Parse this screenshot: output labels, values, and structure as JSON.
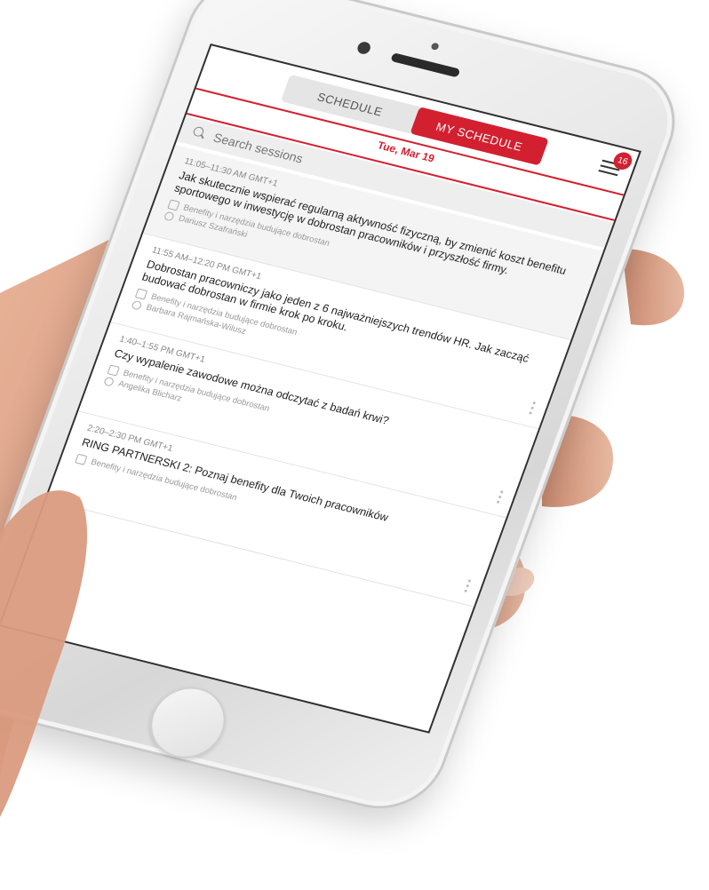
{
  "tabs": [
    {
      "label": "SCHEDULE",
      "active": false
    },
    {
      "label": "MY SCHEDULE",
      "active": true
    }
  ],
  "badge_count": "16",
  "date": "Tue, Mar 19",
  "search": {
    "placeholder": "Search sessions"
  },
  "sessions": [
    {
      "time": "11:05–11:30 AM GMT+1",
      "title": "Jak skutecznie wspierać regularną aktywność fizyczną, by zmienić koszt benefitu sportowego w inwestycję w dobrostan pracowników i przyszłość firmy.",
      "track": "Benefity i narzędzia budujące dobrostan",
      "speaker": "Dariusz Szafrański"
    },
    {
      "time": "11:55 AM–12:20 PM GMT+1",
      "title": "Dobrostan pracowniczy jako jeden z 6 najważniejszych trendów HR. Jak zacząć budować dobrostan w firmie krok po kroku.",
      "track": "Benefity i narzędzia budujące dobrostan",
      "speaker": "Barbara Rajmańska-Wilusz"
    },
    {
      "time": "1:40–1:55 PM GMT+1",
      "title": "Czy wypalenie zawodowe można odczytać z badań krwi?",
      "track": "Benefity i narzędzia budujące dobrostan",
      "speaker": "Angelika Blicharz"
    },
    {
      "time": "2:20–2:30 PM GMT+1",
      "title": "RING PARTNERSKI 2: Poznaj benefity dla Twoich pracowników",
      "track": "Benefity i narzędzia budujące dobrostan",
      "speaker": ""
    }
  ],
  "colors": {
    "accent": "#d32030",
    "background": "#ffffff"
  }
}
